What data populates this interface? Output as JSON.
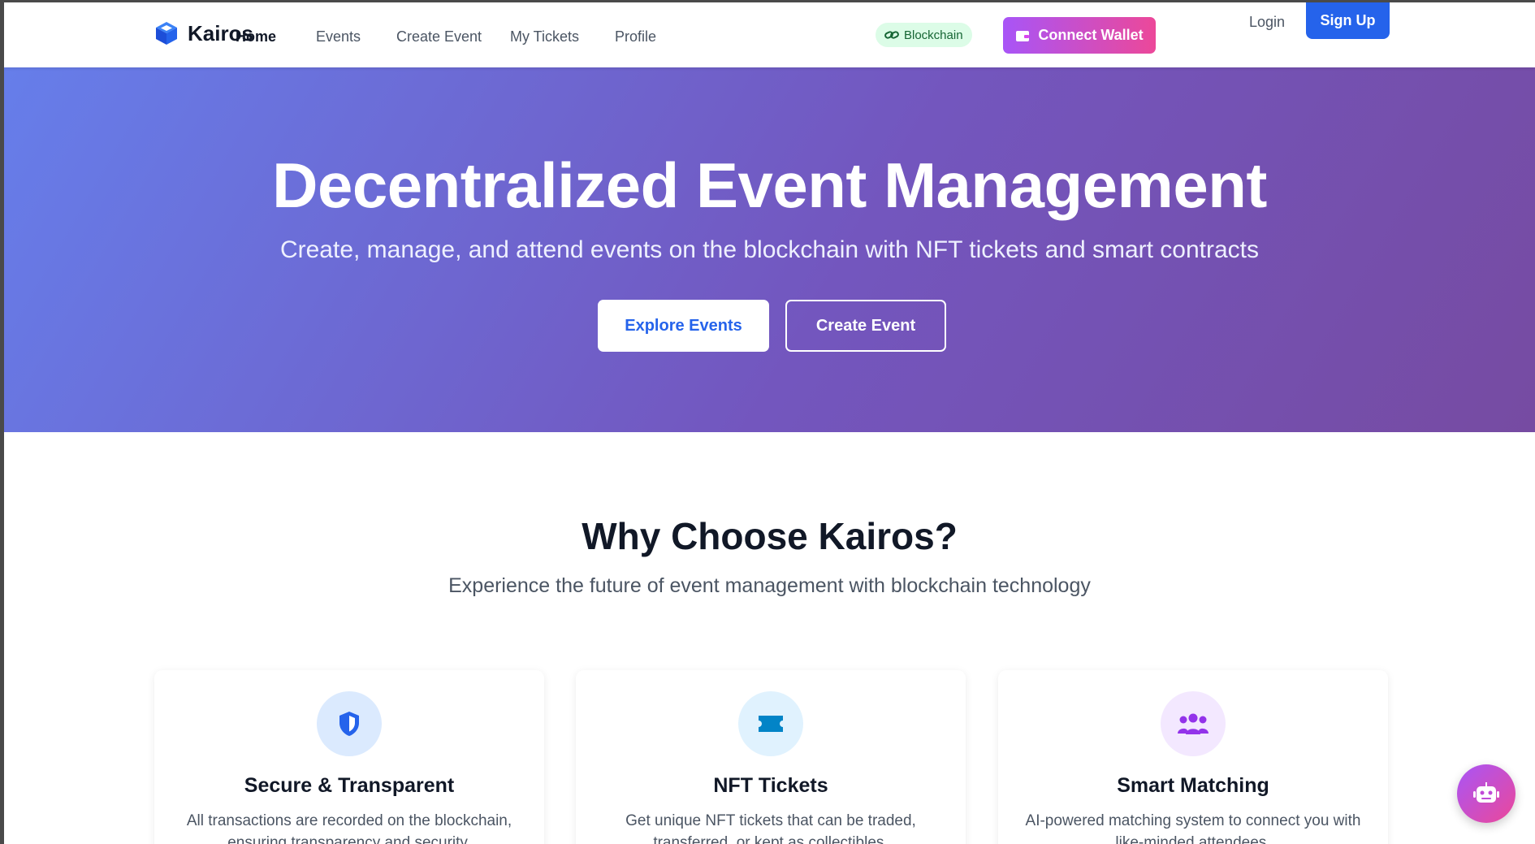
{
  "brand": {
    "name": "Kairos",
    "icon": "cube-icon",
    "color": "#2563eb"
  },
  "nav": {
    "links": [
      "Home",
      "Events",
      "Create Event",
      "My Tickets",
      "Profile"
    ],
    "active": "Home",
    "badge": {
      "label": "Blockchain",
      "icon": "link-icon",
      "bg": "#dcfce7",
      "color": "#166534"
    },
    "wallet_button": {
      "label": "Connect Wallet",
      "icon": "wallet-icon"
    },
    "login": "Login",
    "signup": "Sign Up"
  },
  "hero": {
    "title": "Decentralized Event Management",
    "subtitle": "Create, manage, and attend events on the blockchain with NFT tickets and smart contracts",
    "explore_button": "Explore Events",
    "create_button": "Create Event"
  },
  "why": {
    "title": "Why Choose Kairos?",
    "subtitle": "Experience the future of event management with blockchain technology",
    "cards": [
      {
        "title": "Secure & Transparent",
        "text": "All transactions are recorded on the blockchain, ensuring transparency and security.",
        "icon": "shield-icon",
        "icon_bg": "#dbeafe",
        "icon_color": "#2563eb"
      },
      {
        "title": "NFT Tickets",
        "text": "Get unique NFT tickets that can be traded, transferred, or kept as collectibles.",
        "icon": "ticket-icon",
        "icon_bg": "#e0f2fe",
        "icon_color": "#0284c7"
      },
      {
        "title": "Smart Matching",
        "text": "AI-powered matching system to connect you with like-minded attendees.",
        "icon": "users-icon",
        "icon_bg": "#f3e8ff",
        "icon_color": "#9333ea"
      }
    ]
  },
  "chat_button": {
    "icon": "robot-icon"
  }
}
